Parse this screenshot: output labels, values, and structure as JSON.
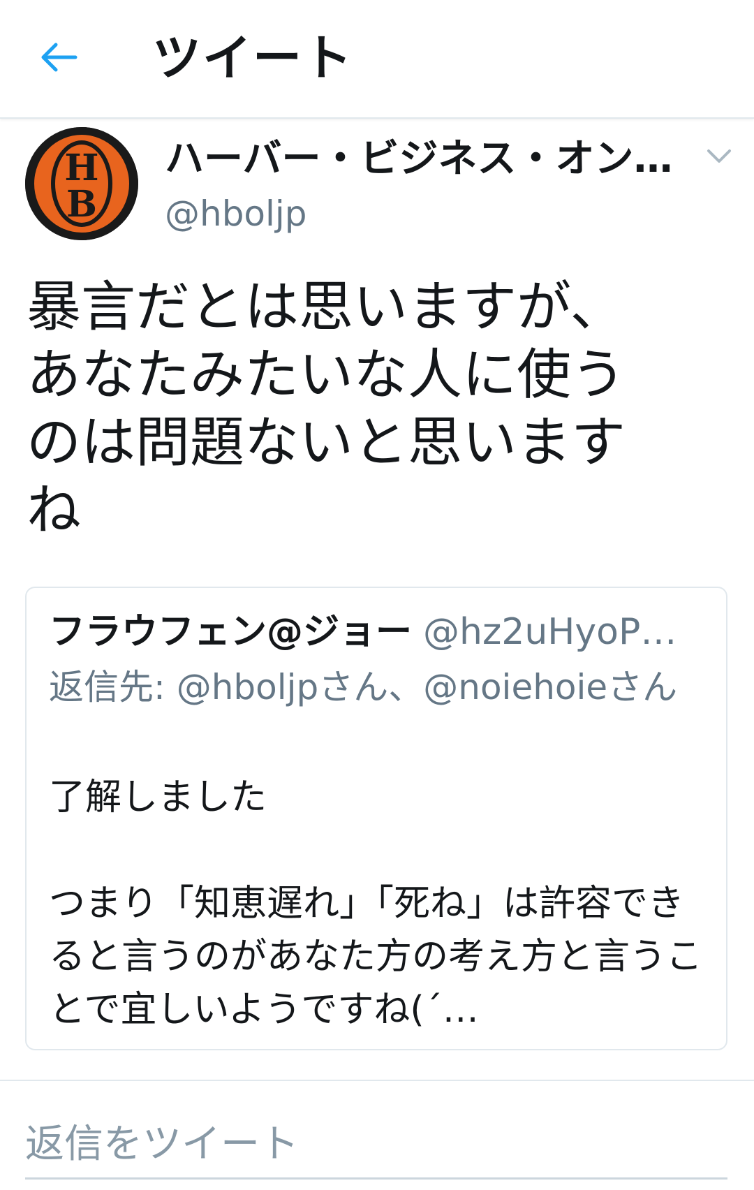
{
  "header": {
    "title": "ツイート",
    "back_icon": "arrow-left-icon",
    "accent_color": "#1da1f2"
  },
  "tweet": {
    "author": {
      "display_name": "ハーバー・ビジネス・オン…",
      "handle": "@hboljp",
      "avatar_letters": [
        "H",
        "B"
      ],
      "avatar_colors": {
        "ring": "#e8641e",
        "bg": "#1a1a1a"
      }
    },
    "text": "暴言だとは思いますが、\nあなたみたいな人に使う\nのは問題ないと思います\nね",
    "caret_icon": "chevron-down-icon"
  },
  "quoted_tweet": {
    "display_name": "フラウフェン@ジョー",
    "handle": "@hz2uHyoP…",
    "reply_to": "返信先: @hboljpさん、@noiehoieさん",
    "text": "了解しました\n\nつまり「知恵遅れ」「死ね」は許容できると言うのがあなた方の考え方と言うことで宜しいようですね(´…"
  },
  "reply": {
    "placeholder": "返信をツイート"
  }
}
